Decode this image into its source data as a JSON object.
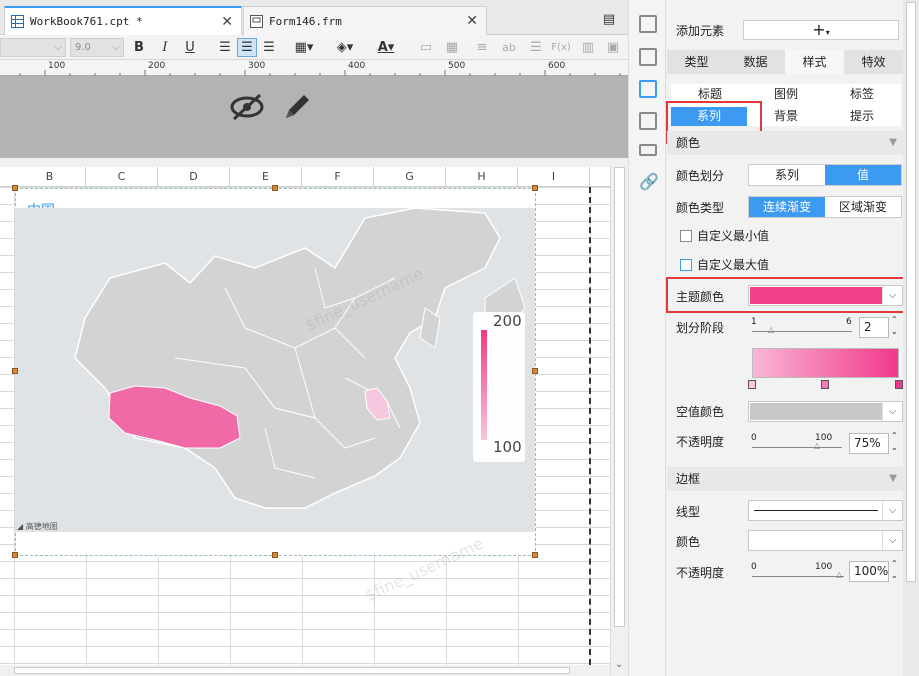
{
  "tabs": [
    {
      "title": "WorkBook761.cpt *"
    },
    {
      "title": "Form146.frm"
    }
  ],
  "toolbar": {
    "font_name": "",
    "font_size": "9.0",
    "bold": "B",
    "italic": "I",
    "underline": "U",
    "font_color_letter": "A",
    "ab": "ab",
    "fx": "F(x)"
  },
  "ruler": {
    "ticks": [
      "100",
      "200",
      "300",
      "400",
      "500",
      "600"
    ]
  },
  "columns": [
    "B",
    "C",
    "D",
    "E",
    "F",
    "G",
    "H",
    "I"
  ],
  "chart": {
    "title": "中国",
    "legend_max": "200",
    "legend_min": "100",
    "watermark": "$fine_username",
    "attribution": "◢ 高德地图"
  },
  "panel": {
    "add_element_label": "添加元素",
    "add_button": "+",
    "main_tabs": [
      "类型",
      "数据",
      "样式",
      "特效"
    ],
    "active_main_tab": "样式",
    "sub_tabs_row1": [
      "标题",
      "图例",
      "标签"
    ],
    "sub_tabs_row2": [
      "系列",
      "背景",
      "提示"
    ],
    "active_sub_tab": "系列",
    "color_section": "颜色",
    "color_division_label": "颜色划分",
    "color_division_options": [
      "系列",
      "值"
    ],
    "color_type_label": "颜色类型",
    "color_type_options": [
      "连续渐变",
      "区域渐变"
    ],
    "custom_min_label": "自定义最小值",
    "custom_max_label": "自定义最大值",
    "theme_color_label": "主题颜色",
    "theme_color": "#f23f8a",
    "division_stage_label": "划分阶段",
    "stage_min": "1",
    "stage_max": "6",
    "stage_value": "2",
    "gradient_from": "#f9b6d6",
    "gradient_to": "#f0398a",
    "null_color_label": "空值颜色",
    "opacity_label": "不透明度",
    "opacity_min": "0",
    "opacity_max": "100",
    "opacity_value": "75%",
    "border_section": "边框",
    "line_type_label": "线型",
    "border_color_label": "颜色",
    "border_opacity_label": "不透明度",
    "border_opacity_min": "0",
    "border_opacity_max": "100",
    "border_opacity_value": "100%"
  },
  "colors": {
    "accent": "#3c9bf0",
    "highlight": "#e23a3a",
    "tibet": "#f06aa8",
    "anhui": "#f5c6dd"
  }
}
